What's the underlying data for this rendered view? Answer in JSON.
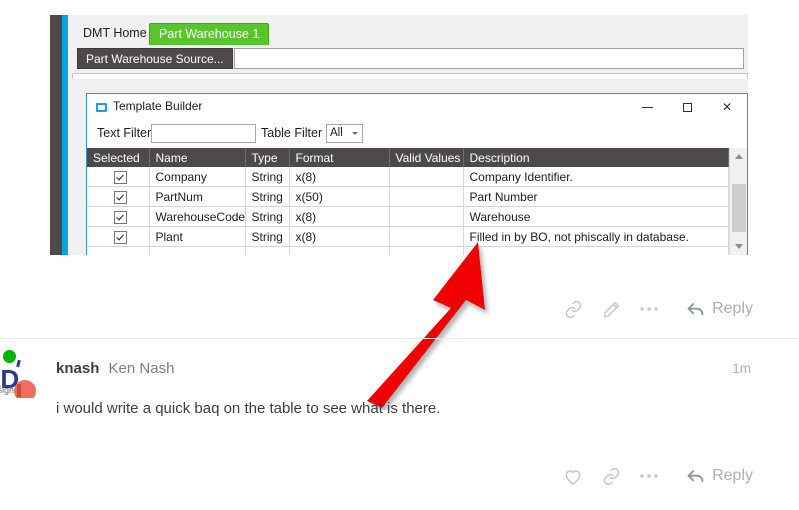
{
  "screenshot": {
    "tabs": [
      {
        "label": "DMT Home",
        "active": false
      },
      {
        "label": "Part Warehouse 1",
        "active": true
      }
    ],
    "source_bar": {
      "button_label": "Part Warehouse Source...",
      "input_value": "",
      "input_placeholder": ""
    },
    "dialog": {
      "title": "Template Builder",
      "window_icon": "window-icon",
      "controls": {
        "minimize": "minimize-icon",
        "maximize": "maximize-icon",
        "close": "close-icon"
      },
      "filters": {
        "text_filter_label": "Text Filter",
        "text_filter_value": "",
        "text_filter_placeholder": "",
        "table_filter_label": "Table Filter",
        "table_filter_value": "All",
        "table_filter_options": [
          "All"
        ]
      },
      "table": {
        "columns": [
          "Selected",
          "Name",
          "Type",
          "Format",
          "Valid Values",
          "Description"
        ],
        "rows": [
          {
            "selected": true,
            "name": "Company",
            "type": "String",
            "format": "x(8)",
            "valid_values": "",
            "description": "Company Identifier."
          },
          {
            "selected": true,
            "name": "PartNum",
            "type": "String",
            "format": "x(50)",
            "valid_values": "",
            "description": "Part Number"
          },
          {
            "selected": true,
            "name": "WarehouseCode",
            "type": "String",
            "format": "x(8)",
            "valid_values": "",
            "description": "Warehouse"
          },
          {
            "selected": true,
            "name": "Plant",
            "type": "String",
            "format": "x(8)",
            "valid_values": "",
            "description": "Filled in by BO, not phiscally in database."
          }
        ]
      }
    },
    "annotation": {
      "type": "red-arrow",
      "color": "#f00000",
      "points_to": "Plant row description cell"
    }
  },
  "post_actions_top": {
    "link_label": "link-icon",
    "edit_label": "edit-pencil-icon",
    "more_label": "more-ellipsis-icon",
    "reply_label": "Reply"
  },
  "comment": {
    "username": "knash",
    "display_name": "Ken Nash",
    "timestamp": "1m",
    "text": "i would write a quick baq on the table to see what is there.",
    "avatar": {
      "logo_primary": "ED",
      "logo_secondary": "Design",
      "status": "online"
    }
  },
  "post_actions_bottom": {
    "like_label": "heart-icon",
    "link_label": "link-icon",
    "more_label": "more-ellipsis-icon",
    "reply_label": "Reply"
  },
  "colors": {
    "tab_active": "#58c52b",
    "accent_blue": "#00a5e4",
    "header_gray": "#4d4a49",
    "arrow_red": "#f00000",
    "status_green": "#00b300"
  }
}
